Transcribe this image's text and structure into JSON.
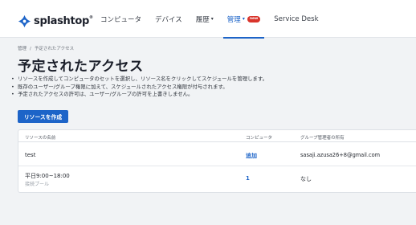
{
  "brand": {
    "name": "splashtop",
    "mark": "®"
  },
  "nav": {
    "items": [
      {
        "label": "コンピュータ",
        "caret": "",
        "badge": ""
      },
      {
        "label": "デバイス",
        "caret": "",
        "badge": ""
      },
      {
        "label": "履歴",
        "caret": "▾",
        "badge": ""
      },
      {
        "label": "管理",
        "caret": "▾",
        "badge": "NEW"
      },
      {
        "label": "Service Desk",
        "caret": "",
        "badge": ""
      }
    ]
  },
  "breadcrumb": {
    "root": "管理",
    "separator": "/",
    "current": "予定されたアクセス"
  },
  "page": {
    "title": "予定されたアクセス"
  },
  "info": [
    "リソースを作成してコンピュータのセットを選択し、リソース名をクリックしてスケジュールを管理します。",
    "既存のユーザー/グループ権限に加えて、スケジュールされたアクセス権限が付与されます。",
    "予定されたアクセスの許可は、ユーザー/グループの許可を上書きしません。"
  ],
  "actions": {
    "create_label": "リソースを作成"
  },
  "table": {
    "headers": {
      "name": "リソースの名前",
      "computer": "コンピュータ",
      "owner": "グループ管理者の所有"
    },
    "rows": [
      {
        "name": "test",
        "sub": "",
        "computer": "追加",
        "owner": "sasaji.azusa26+8@gmail.com"
      },
      {
        "name": "平日9:00~18:00",
        "sub": "接続プール",
        "computer": "1",
        "owner": "なし"
      }
    ]
  },
  "colors": {
    "accent": "#1d64c8",
    "badge": "#d9342b",
    "background": "#f1f3f5"
  },
  "icons": {
    "logo": "splashtop-logo-icon",
    "dropdown": "chevron-down-icon"
  }
}
